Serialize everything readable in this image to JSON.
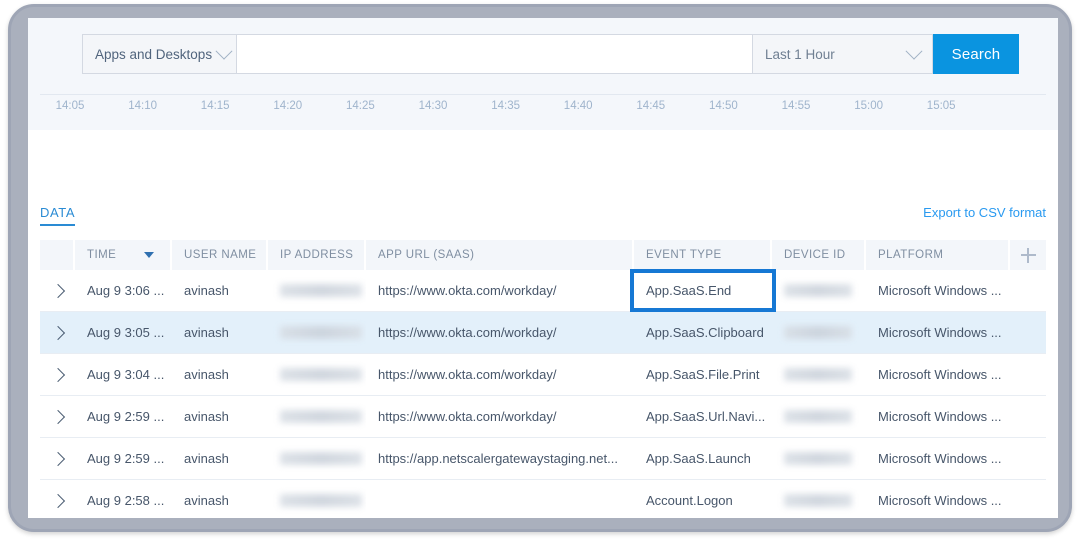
{
  "toolbar": {
    "resource_filter": "Apps and Desktops",
    "search_placeholder": "",
    "search_value": "",
    "time_range": "Last 1 Hour",
    "search_label": "Search",
    "accent_color": "#0a94e0"
  },
  "chart_data": {
    "type": "line",
    "title": "",
    "xlabel": "",
    "ylabel": "",
    "grid": false,
    "legend": "none",
    "categories": [
      "14:05",
      "14:10",
      "14:15",
      "14:20",
      "14:25",
      "14:30",
      "14:35",
      "14:40",
      "14:45",
      "14:50",
      "14:55",
      "15:00",
      "15:05"
    ],
    "values": [],
    "x_tick_labels": [
      "14:05",
      "14:10",
      "14:15",
      "14:20",
      "14:25",
      "14:30",
      "14:35",
      "14:40",
      "14:45",
      "14:50",
      "14:55",
      "15:00",
      "15:05"
    ],
    "note": "Only the x-axis tick strip of the timeline chart is visible in this crop; no plotted series pixels are shown."
  },
  "panel": {
    "tab_label": "DATA",
    "export_label": "Export to CSV format",
    "link_color": "#2a9af0"
  },
  "table": {
    "columns": [
      {
        "key": "expander",
        "label": ""
      },
      {
        "key": "time",
        "label": "TIME",
        "sorted": true
      },
      {
        "key": "user_name",
        "label": "USER NAME"
      },
      {
        "key": "ip_address",
        "label": "IP ADDRESS"
      },
      {
        "key": "app_url",
        "label": "APP URL (SAAS)"
      },
      {
        "key": "event_type",
        "label": "EVENT TYPE"
      },
      {
        "key": "device_id",
        "label": "DEVICE ID"
      },
      {
        "key": "platform",
        "label": "PLATFORM"
      },
      {
        "key": "add",
        "label": ""
      }
    ],
    "add_column_icon": "plus-icon",
    "rows": [
      {
        "time": "Aug 9 3:06 ...",
        "user_name": "avinash",
        "ip_address": "",
        "app_url": "https://www.okta.com/workday/",
        "event_type": "App.SaaS.End",
        "device_id": "",
        "platform": "Microsoft Windows ...",
        "hovered": false,
        "highlighted_cell": "event_type"
      },
      {
        "time": "Aug 9 3:05 ...",
        "user_name": "avinash",
        "ip_address": "",
        "app_url": "https://www.okta.com/workday/",
        "event_type": "App.SaaS.Clipboard",
        "device_id": "",
        "platform": "Microsoft Windows ...",
        "hovered": true,
        "highlighted_cell": ""
      },
      {
        "time": "Aug 9 3:04 ...",
        "user_name": "avinash",
        "ip_address": "",
        "app_url": "https://www.okta.com/workday/",
        "event_type": "App.SaaS.File.Print",
        "device_id": "",
        "platform": "Microsoft Windows ...",
        "hovered": false,
        "highlighted_cell": ""
      },
      {
        "time": "Aug 9 2:59 ...",
        "user_name": "avinash",
        "ip_address": "",
        "app_url": "https://www.okta.com/workday/",
        "event_type": "App.SaaS.Url.Navi...",
        "device_id": "",
        "platform": "Microsoft Windows ...",
        "hovered": false,
        "highlighted_cell": ""
      },
      {
        "time": "Aug 9 2:59 ...",
        "user_name": "avinash",
        "ip_address": "",
        "app_url": "https://app.netscalergatewaystaging.net...",
        "event_type": "App.SaaS.Launch",
        "device_id": "",
        "platform": "Microsoft Windows ...",
        "hovered": false,
        "highlighted_cell": ""
      },
      {
        "time": "Aug 9 2:58 ...",
        "user_name": "avinash",
        "ip_address": "",
        "app_url": "",
        "event_type": "Account.Logon",
        "device_id": "",
        "platform": "Microsoft Windows ...",
        "hovered": false,
        "highlighted_cell": ""
      }
    ]
  }
}
